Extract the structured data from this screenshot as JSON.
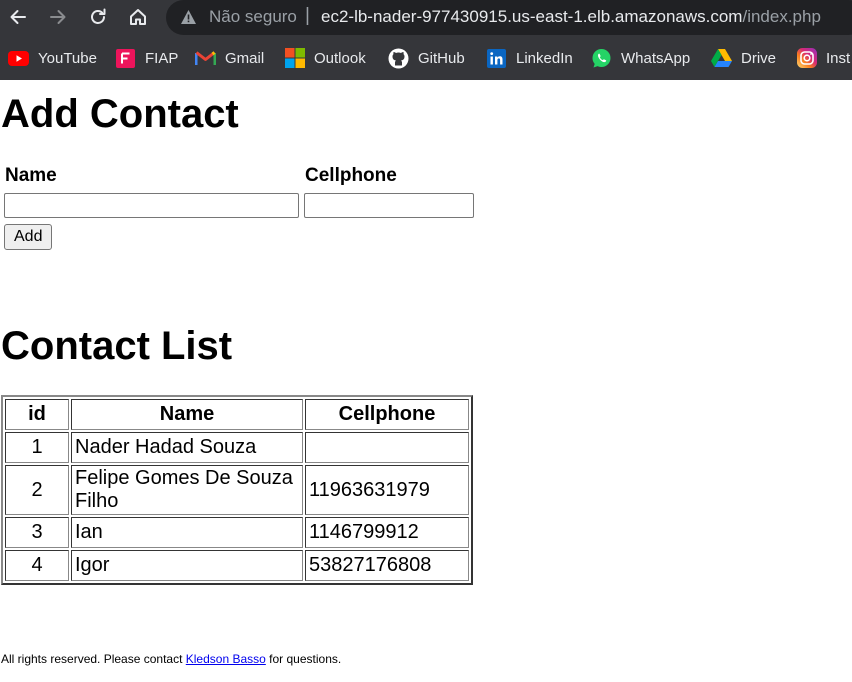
{
  "browser": {
    "insecure_label": "Não seguro",
    "separator": "|",
    "url_host": "ec2-lb-nader-977430915.us-east-1.elb.amazonaws.com",
    "url_path": "/index.php",
    "bookmarks": [
      {
        "label": "YouTube",
        "icon": "youtube-icon",
        "color": "#ff0000"
      },
      {
        "label": "FIAP",
        "icon": "fiap-icon",
        "color": "#ed145b"
      },
      {
        "label": "Gmail",
        "icon": "gmail-icon",
        "color": "#ea4335"
      },
      {
        "label": "Outlook",
        "icon": "microsoft-icon",
        "color": "#f25022"
      },
      {
        "label": "GitHub",
        "icon": "github-icon",
        "color": "#ffffff"
      },
      {
        "label": "LinkedIn",
        "icon": "linkedin-icon",
        "color": "#0a66c2"
      },
      {
        "label": "WhatsApp",
        "icon": "whatsapp-icon",
        "color": "#25d366"
      },
      {
        "label": "Drive",
        "icon": "drive-icon",
        "color": "#1fa463"
      },
      {
        "label": "Inst",
        "icon": "instagram-icon",
        "color": "#e1306c"
      }
    ]
  },
  "add_contact": {
    "title": "Add Contact",
    "name_label": "Name",
    "cellphone_label": "Cellphone",
    "name_value": "",
    "cellphone_value": "",
    "add_button": "Add"
  },
  "contact_list": {
    "title": "Contact List",
    "headers": [
      "id",
      "Name",
      "Cellphone"
    ],
    "rows": [
      {
        "id": "1",
        "name": "Nader Hadad Souza",
        "cellphone": ""
      },
      {
        "id": "2",
        "name": "Felipe Gomes De Souza Filho",
        "cellphone": "11963631979"
      },
      {
        "id": "3",
        "name": "Ian",
        "cellphone": "1146799912"
      },
      {
        "id": "4",
        "name": "Igor",
        "cellphone": "53827176808"
      }
    ]
  },
  "footer": {
    "prefix": "All rights reserved. Please contact ",
    "link_text": "Kledson Basso",
    "suffix": " for questions."
  }
}
